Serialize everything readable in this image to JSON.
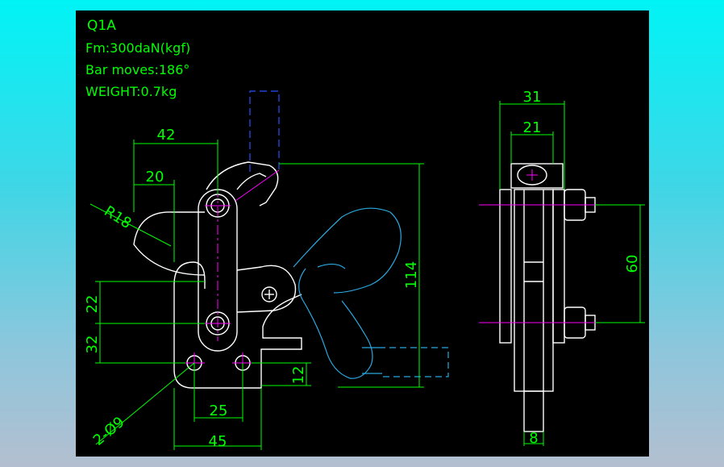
{
  "drawing": {
    "title_block": {
      "model": "Q1A",
      "force": "Fm:300daN(kgf)",
      "bar_moves": "Bar moves:186°",
      "weight": "WEIGHT:0.7kg"
    },
    "dimensions": {
      "width_42": "42",
      "width_20": "20",
      "radius_r18": "R18",
      "height_114": "114",
      "height_22": "22",
      "height_32": "32",
      "height_12": "12",
      "spacing_25": "25",
      "base_45": "45",
      "holes_2x9": "2-Ø9",
      "side_31": "31",
      "side_21": "21",
      "side_60": "60",
      "side_8": "8"
    },
    "colors": {
      "background": "#000000",
      "outline": "#ffffff",
      "dimension": "#00ff00",
      "centerline": "#ff00ff",
      "handle_alt_position": "#2aa8e0",
      "spindle_hidden": "#2a4fff"
    }
  }
}
